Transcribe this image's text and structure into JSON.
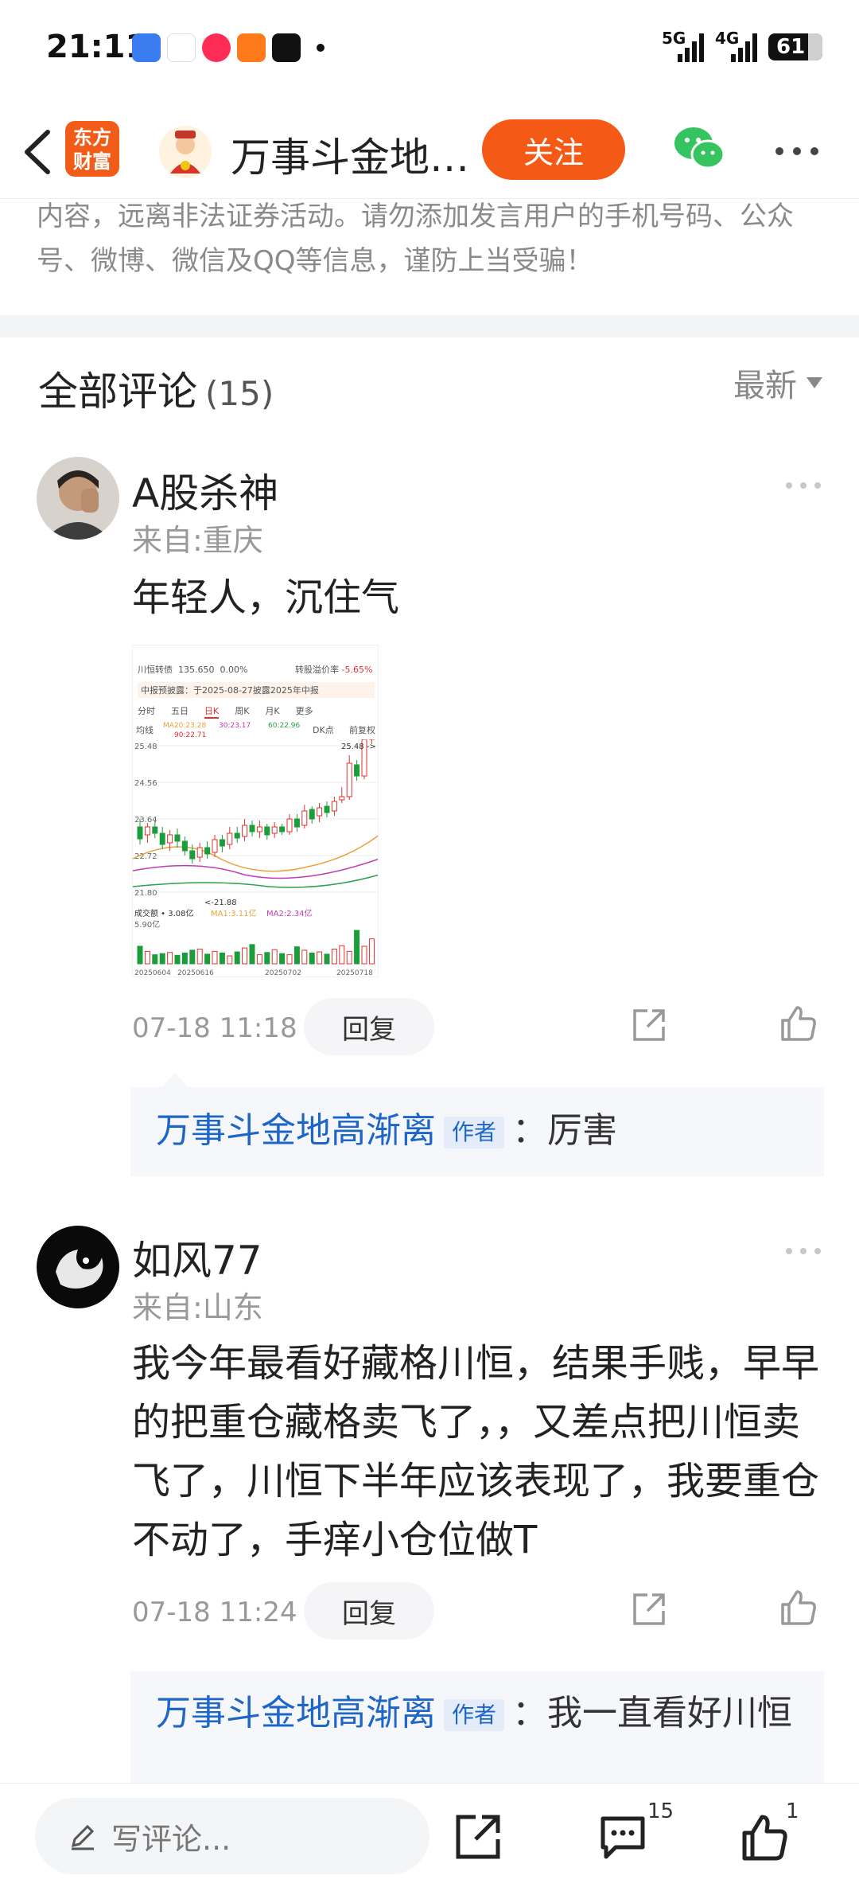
{
  "status_bar": {
    "time": "21:11",
    "net1": "5G",
    "net2": "4G",
    "battery": "61"
  },
  "header": {
    "brand_logo": "东方\n财富",
    "title": "万事斗金地…",
    "follow_label": "关注"
  },
  "notice": "内容，远离非法证券活动。请勿添加发言用户的手机号码、公众号、微博、微信及QQ等信息，谨防上当受骗！",
  "comments_header": {
    "title": "全部评论",
    "count": "(15)",
    "sort_label": "最新"
  },
  "comments": [
    {
      "name": "A股杀神",
      "location": "来自:重庆",
      "text": "年轻人，沉住气",
      "time": "07-18 11:18",
      "reply_label": "回复",
      "reply": {
        "author": "万事斗金地高渐离",
        "tag": "作者",
        "text": "：厉害"
      }
    },
    {
      "name": "如风77",
      "location": "来自:山东",
      "text": "我今年最看好藏格川恒，结果手贱，早早的把重仓藏格卖飞了，，又差点把川恒卖飞了，川恒下半年应该表现了，我要重仓不动了，手痒小仓位做T",
      "time": "07-18 11:24",
      "reply_label": "回复",
      "reply": {
        "author": "万事斗金地高渐离",
        "tag": "作者",
        "text": "：我一直看好川恒"
      }
    }
  ],
  "stock_image": {
    "row1_name": "川恒转债",
    "row1_price": "135.650",
    "row1_chg": "0.00%",
    "row1_label": "转股溢价率",
    "row1_val": "-5.65%",
    "notice": "中报预披露：于2025-08-27披露2025年中报",
    "tabs": [
      "分时",
      "五日",
      "日K",
      "周K",
      "月K",
      "更多"
    ],
    "ma_label": "均线",
    "ma20": "MA20:23.28",
    "ma30": "30:23.17",
    "ma60": "60:22.96",
    "ma90": "90:22.71",
    "dk": "DK点",
    "fq": "前复权",
    "y_labels": [
      "25.48",
      "24.56",
      "23.64",
      "22.72",
      "21.80"
    ],
    "high_label": "25.48",
    "low_label": "21.88",
    "vol_label": "成交额 • 3.08亿",
    "vol_ma1": "MA1:3.11亿",
    "vol_ma2": "MA2:2.34亿",
    "vol_max": "5.90亿",
    "dates": [
      "20250604",
      "20250616",
      "20250702",
      "20250718"
    ],
    "volumes": [
      3.1,
      2.2,
      1.6,
      1.8,
      2.0,
      1.5,
      1.9,
      2.4,
      2.6,
      1.7,
      2.2,
      1.9,
      1.4,
      2.1,
      2.8,
      3.4,
      1.6,
      2.0,
      2.5,
      1.8,
      1.6,
      3.0,
      2.4,
      1.9,
      2.1,
      1.7,
      2.6,
      3.2,
      2.2,
      5.9,
      3.1,
      4.4
    ]
  },
  "bottom_bar": {
    "write_placeholder": "写评论...",
    "comment_count": "15",
    "like_count": "1"
  }
}
